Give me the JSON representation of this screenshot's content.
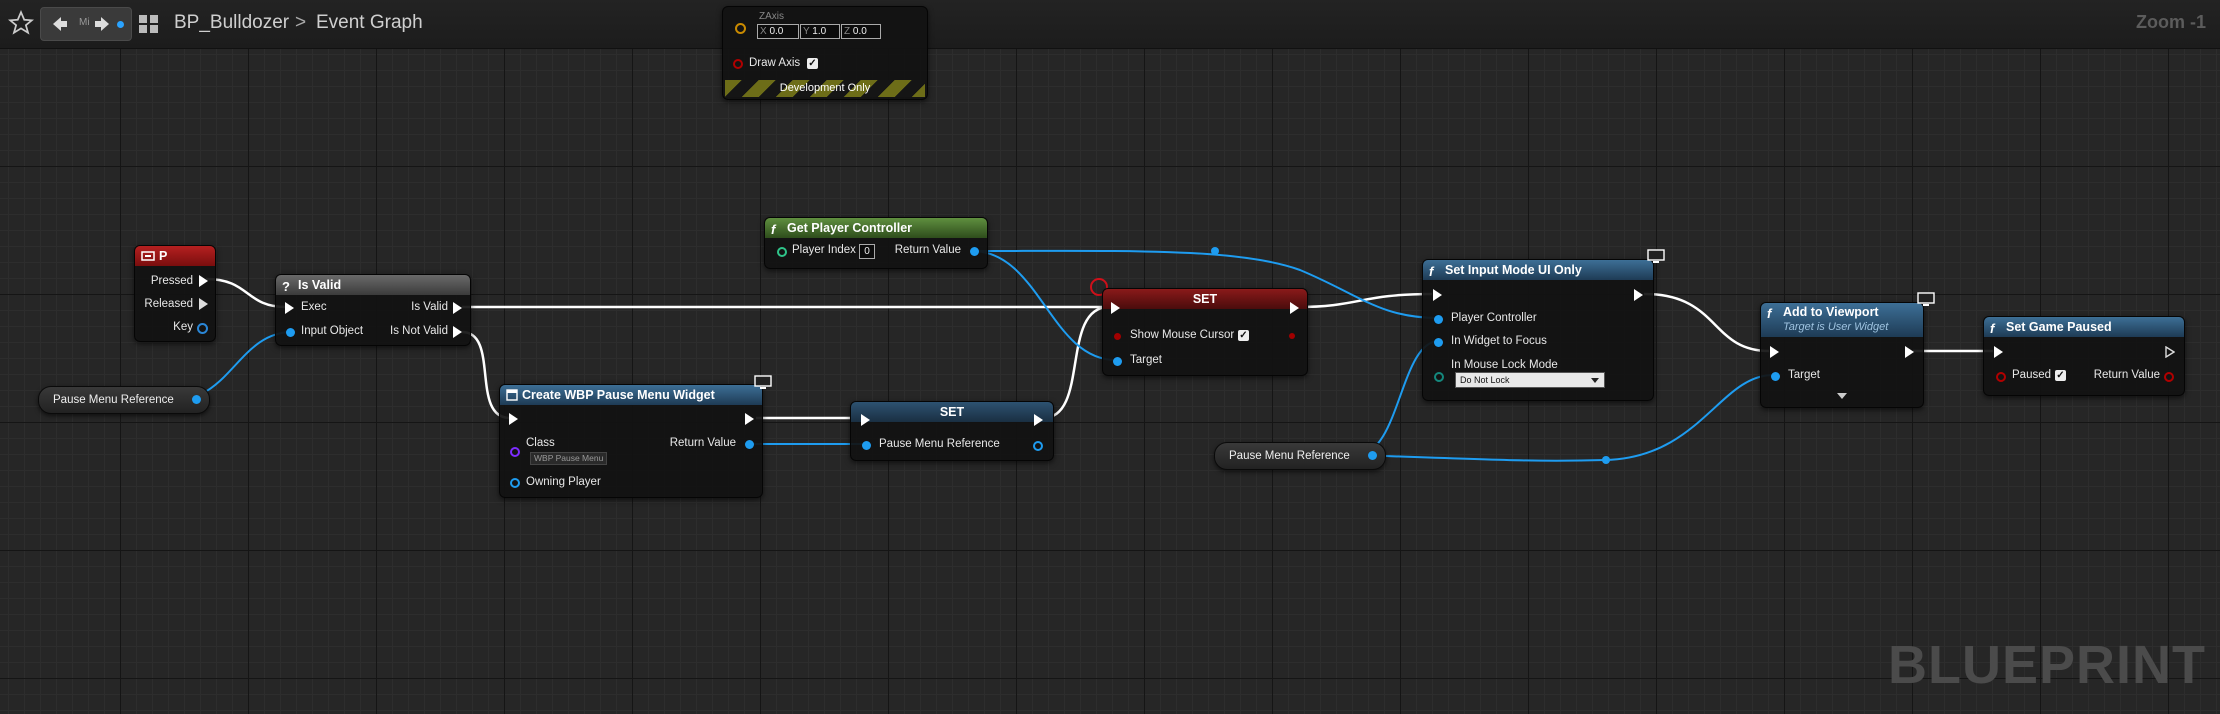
{
  "toolbar": {
    "nav_mini_text": "Mi",
    "breadcrumb_root": "BP_Bulldozer",
    "breadcrumb_separator": ">",
    "breadcrumb_current": "Event Graph",
    "zoom_label": "Zoom -1"
  },
  "nodes": {
    "zaxis": {
      "title": "ZAxis",
      "x_label": "X",
      "x_value": "0.0",
      "y_label": "Y",
      "y_value": "1.0",
      "z_label": "Z",
      "z_value": "0.0",
      "draw_axis_label": "Draw Axis",
      "draw_axis_checked": true,
      "development_label": "Development Only"
    },
    "key_p": {
      "title": "P",
      "pressed": "Pressed",
      "released": "Released",
      "key": "Key"
    },
    "is_valid": {
      "title": "Is Valid",
      "exec": "Exec",
      "input_object": "Input Object",
      "is_valid": "Is Valid",
      "is_not_valid": "Is Not Valid"
    },
    "pause_ref_1": {
      "label": "Pause Menu Reference"
    },
    "get_player_controller": {
      "title": "Get Player Controller",
      "player_index": "Player Index",
      "player_index_value": "0",
      "return_value": "Return Value"
    },
    "create_widget": {
      "title": "Create WBP Pause Menu Widget",
      "class": "Class",
      "class_value": "WBP Pause Menu",
      "return_value": "Return Value",
      "owning_player": "Owning Player"
    },
    "set_ref": {
      "title": "SET",
      "pause_menu_reference": "Pause Menu Reference"
    },
    "set_cursor": {
      "title": "SET",
      "show_mouse_cursor": "Show Mouse Cursor",
      "show_mouse_cursor_checked": true,
      "target": "Target"
    },
    "set_input_mode": {
      "title": "Set Input Mode UI Only",
      "player_controller": "Player Controller",
      "in_widget_to_focus": "In Widget to Focus",
      "in_mouse_lock_mode": "In Mouse Lock Mode",
      "mouse_lock_value": "Do Not Lock"
    },
    "pause_ref_2": {
      "label": "Pause Menu Reference"
    },
    "add_to_viewport": {
      "title": "Add to Viewport",
      "subtitle": "Target is User Widget",
      "target": "Target"
    },
    "set_game_paused": {
      "title": "Set Game Paused",
      "paused": "Paused",
      "paused_checked": true,
      "return_value": "Return Value"
    }
  },
  "watermark": "BLUEPRINT",
  "colors": {
    "graph_bg": "#262626",
    "exec_wire": "#ffffff",
    "object_wire": "#1e9cf0",
    "function_header": "#2f5b7e",
    "pure_header": "#3f6b2d",
    "event_header": "#8a1414",
    "set_header": "#6b1616"
  }
}
